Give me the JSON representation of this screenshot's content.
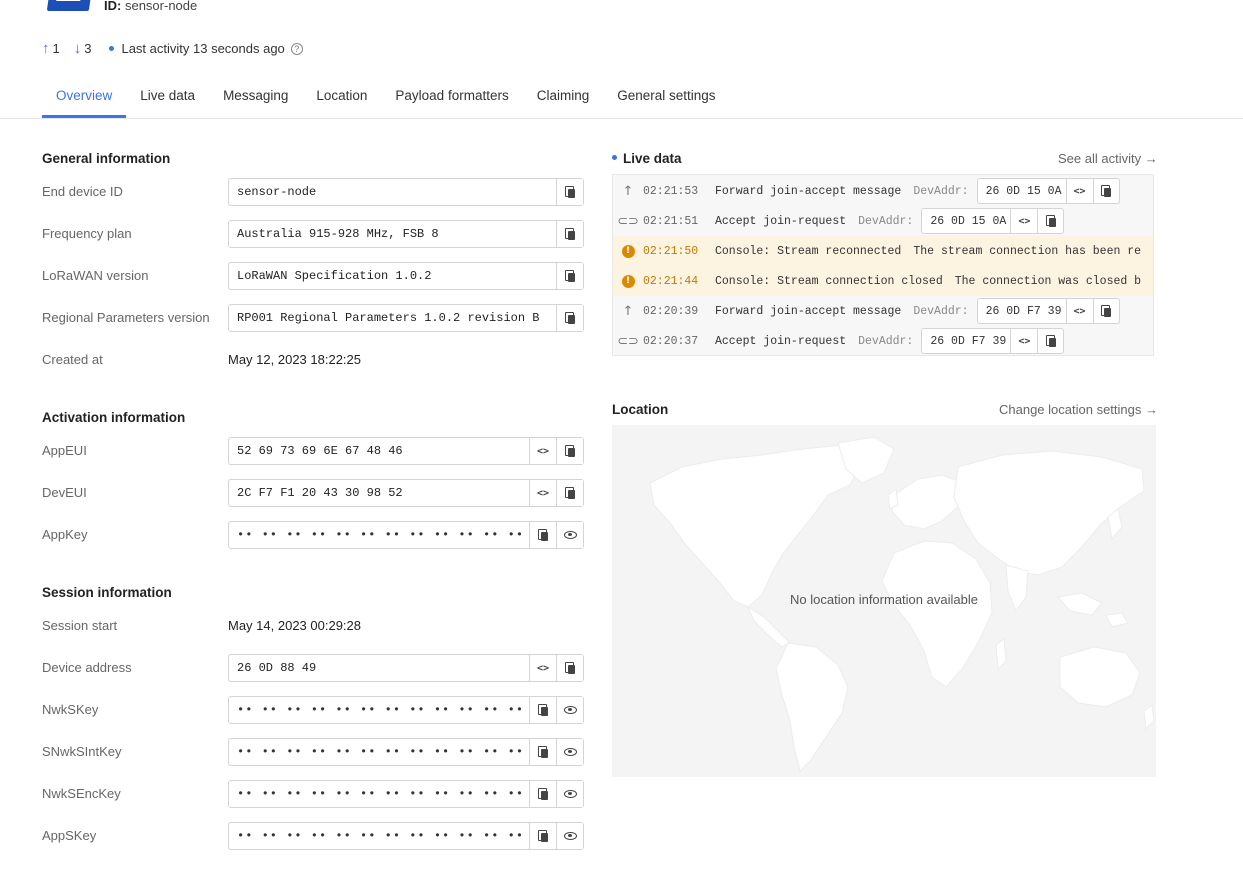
{
  "header": {
    "device_id_label": "ID:",
    "device_id": "sensor-node",
    "uplink_count": "1",
    "downlink_count": "3",
    "last_activity": "Last activity 13 seconds ago"
  },
  "tabs": [
    {
      "label": "Overview",
      "active": true
    },
    {
      "label": "Live data"
    },
    {
      "label": "Messaging"
    },
    {
      "label": "Location"
    },
    {
      "label": "Payload formatters"
    },
    {
      "label": "Claiming"
    },
    {
      "label": "General settings"
    }
  ],
  "general": {
    "title": "General information",
    "end_device_id_label": "End device ID",
    "end_device_id": "sensor-node",
    "frequency_plan_label": "Frequency plan",
    "frequency_plan": "Australia 915-928 MHz, FSB 8",
    "lorawan_version_label": "LoRaWAN version",
    "lorawan_version": "LoRaWAN Specification 1.0.2",
    "regional_params_label": "Regional Parameters version",
    "regional_params": "RP001 Regional Parameters 1.0.2 revision B",
    "created_at_label": "Created at",
    "created_at": "May 12, 2023 18:22:25"
  },
  "activation": {
    "title": "Activation information",
    "appeui_label": "AppEUI",
    "appeui": "52 69 73 69 6E 67 48 46",
    "deveui_label": "DevEUI",
    "deveui": "2C F7 F1 20 43 30 98 52",
    "appkey_label": "AppKey",
    "appkey": "•• •• •• •• •• •• •• •• •• •• •• •• •• •• •• ••"
  },
  "session": {
    "title": "Session information",
    "session_start_label": "Session start",
    "session_start": "May 14, 2023 00:29:28",
    "device_address_label": "Device address",
    "device_address": "26 0D 88 49",
    "nwkskey_label": "NwkSKey",
    "nwkskey": "•• •• •• •• •• •• •• •• •• •• •• •• •• •• •• ••",
    "snwksintkey_label": "SNwkSIntKey",
    "snwksintkey": "•• •• •• •• •• •• •• •• •• •• •• •• •• •• •• ••",
    "nwksenckey_label": "NwkSEncKey",
    "nwksenckey": "•• •• •• •• •• •• •• •• •• •• •• •• •• •• •• ••",
    "appskey_label": "AppSKey",
    "appskey": "•• •• •• •• •• •• •• •• •• •• •• •• •• •• •• ••"
  },
  "live_data": {
    "title": "Live data",
    "see_all": "See all activity →",
    "events": [
      {
        "icon": "arrow-up-icon",
        "time": "02:21:53",
        "message": "Forward join-accept message",
        "devaddr_label": "DevAddr:",
        "devaddr": "26 0D 15 0A"
      },
      {
        "icon": "link-icon",
        "time": "02:21:51",
        "message": "Accept join-request",
        "devaddr_label": "DevAddr:",
        "devaddr": "26 0D 15 0A"
      },
      {
        "icon": "warning-icon",
        "time": "02:21:50",
        "message": "Console: Stream reconnected",
        "detail": "The stream connection has been re"
      },
      {
        "icon": "warning-icon",
        "time": "02:21:44",
        "message": "Console: Stream connection closed",
        "detail": "The connection was closed b"
      },
      {
        "icon": "arrow-up-icon",
        "time": "02:20:39",
        "message": "Forward join-accept message",
        "devaddr_label": "DevAddr:",
        "devaddr": "26 0D F7 39"
      },
      {
        "icon": "link-icon",
        "time": "02:20:37",
        "message": "Accept join-request",
        "devaddr_label": "DevAddr:",
        "devaddr": "26 0D F7 39"
      }
    ]
  },
  "location": {
    "title": "Location",
    "change_link": "Change location settings →",
    "empty_message": "No location information available"
  },
  "colors": {
    "accent": "#3d73e6",
    "warning": "#d98a00",
    "warning_bg": "#fdf3e1"
  }
}
